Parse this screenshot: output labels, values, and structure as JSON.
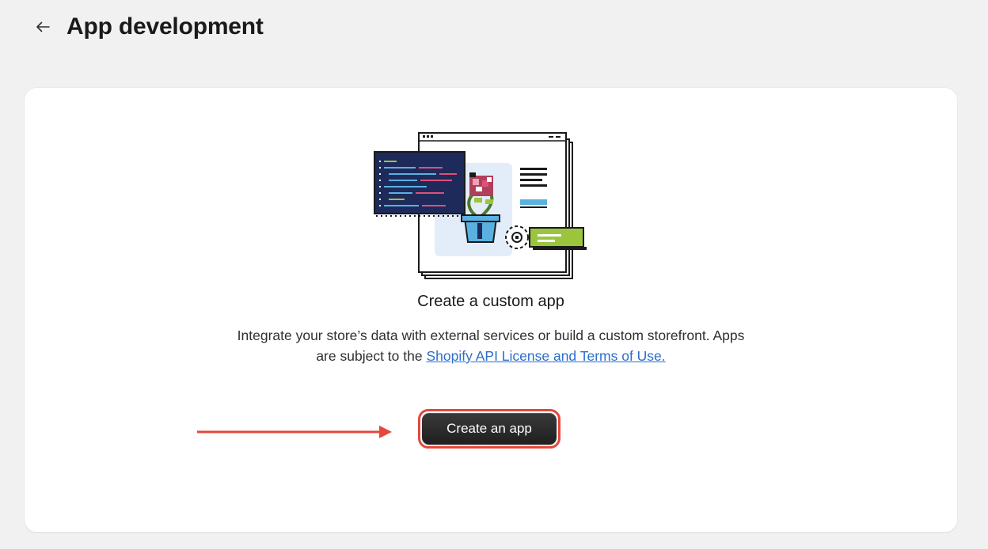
{
  "header": {
    "title": "App development",
    "back_icon": "arrow-left-icon"
  },
  "empty_state": {
    "heading": "Create a custom app",
    "description_before_link": "Integrate your store’s data with external services or build a custom storefront. Apps are subject to the ",
    "link_text": "Shopify API License and Terms of Use.",
    "button_label": "Create an app",
    "illustration_icon": "custom-app-illustration-icon"
  },
  "colors": {
    "page_background": "#f1f1f1",
    "card_background": "#ffffff",
    "link": "#2c6ecb",
    "button": "#303030",
    "annotation": "#e5473a",
    "illustration_navy": "#1e2a5a",
    "illustration_green": "#9bc53d",
    "illustration_blue": "#5ab1e0",
    "illustration_panel": "#e3edfa"
  }
}
